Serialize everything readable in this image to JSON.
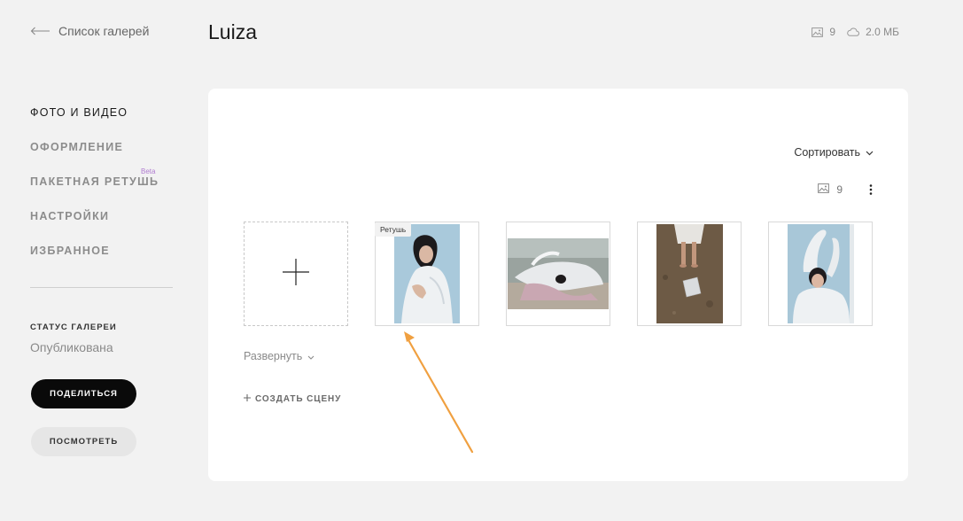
{
  "header": {
    "back_label": "Список галерей",
    "title": "Luiza",
    "photo_count": "9",
    "storage": "2.0 МБ"
  },
  "sidebar": {
    "items": [
      {
        "label": "ФОТО И ВИДЕО",
        "active": true
      },
      {
        "label": "ОФОРМЛЕНИЕ"
      },
      {
        "label": "ПАКЕТНАЯ РЕТУШЬ",
        "badge": "Beta"
      },
      {
        "label": "НАСТРОЙКИ"
      },
      {
        "label": "ИЗБРАННОЕ"
      }
    ],
    "status_title": "СТАТУС ГАЛЕРЕИ",
    "status_value": "Опубликована",
    "share_label": "ПОДЕЛИТЬСЯ",
    "view_label": "ПОСМОТРЕТЬ"
  },
  "gallery": {
    "sort_label": "Сортировать",
    "scene_count": "9",
    "retouch_tag": "Ретушь",
    "expand_label": "Развернуть",
    "create_scene_label": "СОЗДАТЬ СЦЕНУ"
  },
  "colors": {
    "background": "#f2f2f2",
    "card": "#ffffff",
    "primary_button": "#0a0a0a",
    "beta_badge": "#b07cd0",
    "annotation_arrow": "#f0a040"
  }
}
